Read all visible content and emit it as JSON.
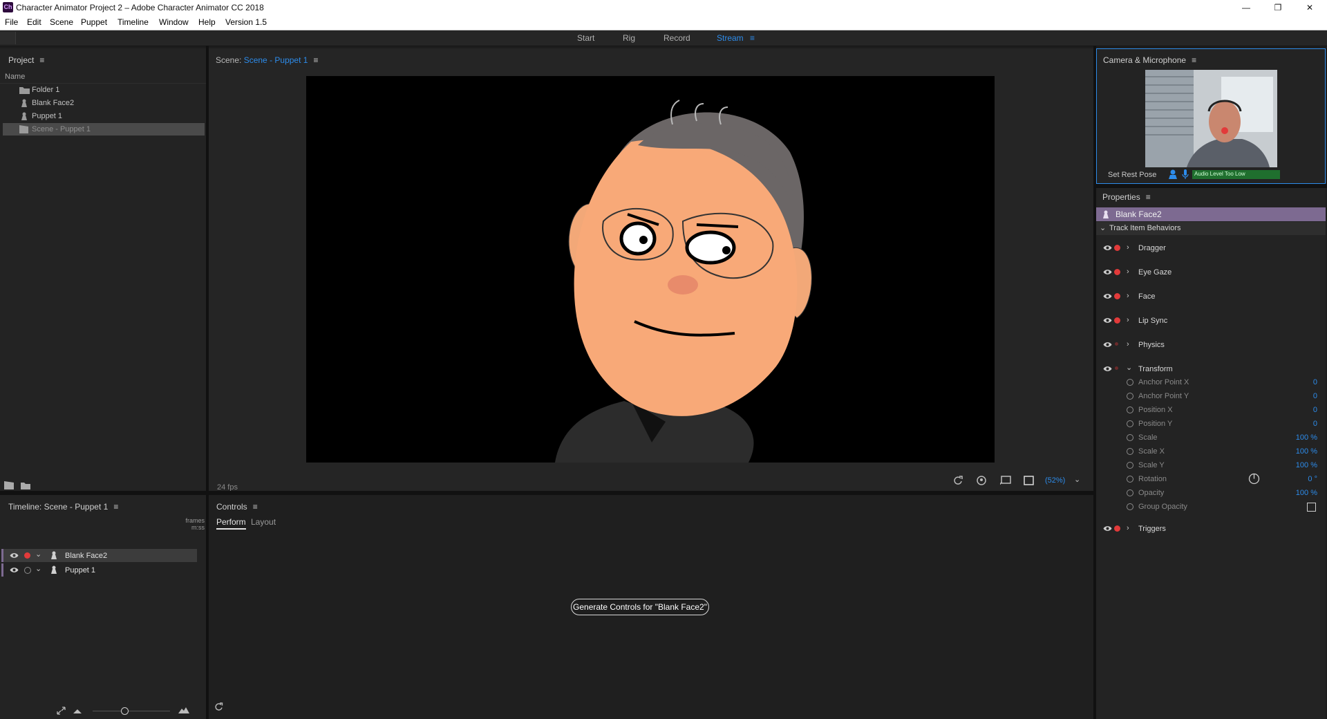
{
  "app": {
    "badge": "Ch",
    "title": "Character Animator Project 2 – Adobe Character Animator CC 2018",
    "window_controls": [
      "—",
      "❐",
      "✕"
    ]
  },
  "menu": [
    {
      "label": "File"
    },
    {
      "label": "Edit"
    },
    {
      "label": "Scene"
    },
    {
      "label": "Puppet"
    },
    {
      "label": "Timeline"
    },
    {
      "label": "Window"
    },
    {
      "label": "Help"
    },
    {
      "label": "Version 1.5"
    }
  ],
  "workspace_tabs": [
    {
      "label": "Start"
    },
    {
      "label": "Rig"
    },
    {
      "label": "Record"
    },
    {
      "label": "Stream",
      "active": true
    }
  ],
  "project": {
    "title": "Project",
    "column": "Name",
    "items": [
      {
        "label": "Folder 1",
        "icon": "folder-icon"
      },
      {
        "label": "Blank Face2",
        "icon": "puppet-icon"
      },
      {
        "label": "Puppet 1",
        "icon": "puppet-icon"
      },
      {
        "label": "Scene - Puppet 1",
        "icon": "scene-icon",
        "selected": true
      }
    ]
  },
  "scene": {
    "title_prefix": "Scene:",
    "title_name": "Scene - Puppet 1",
    "fps": "24 fps",
    "zoom": "(52%)"
  },
  "camera": {
    "title": "Camera & Microphone",
    "set_rest_pose": "Set Rest Pose",
    "audio_status": "Audio Level Too Low"
  },
  "properties": {
    "title": "Properties",
    "selected_item": "Blank Face2",
    "section": "Track Item Behaviors",
    "behaviors": [
      "Dragger",
      "Eye Gaze",
      "Face",
      "Lip Sync",
      "Physics",
      "Transform"
    ],
    "transform_params": [
      {
        "label": "Anchor Point X",
        "value": "0"
      },
      {
        "label": "Anchor Point Y",
        "value": "0"
      },
      {
        "label": "Position X",
        "value": "0"
      },
      {
        "label": "Position Y",
        "value": "0"
      },
      {
        "label": "Scale",
        "value": "100 %"
      },
      {
        "label": "Scale X",
        "value": "100 %"
      },
      {
        "label": "Scale Y",
        "value": "100 %"
      },
      {
        "label": "Rotation",
        "value": "0 °"
      },
      {
        "label": "Opacity",
        "value": "100 %"
      },
      {
        "label": "Group Opacity",
        "value": ""
      }
    ],
    "triggers": "Triggers"
  },
  "timeline": {
    "title": "Timeline: Scene - Puppet 1",
    "units_top": "frames",
    "units_bottom": "m:ss",
    "tracks": [
      {
        "label": "Blank Face2",
        "armed": true
      },
      {
        "label": "Puppet 1",
        "armed": false
      }
    ]
  },
  "controls": {
    "title": "Controls",
    "tabs": [
      {
        "label": "Perform",
        "active": true
      },
      {
        "label": "Layout"
      }
    ],
    "generate_button": "Generate Controls for \"Blank Face2\""
  }
}
